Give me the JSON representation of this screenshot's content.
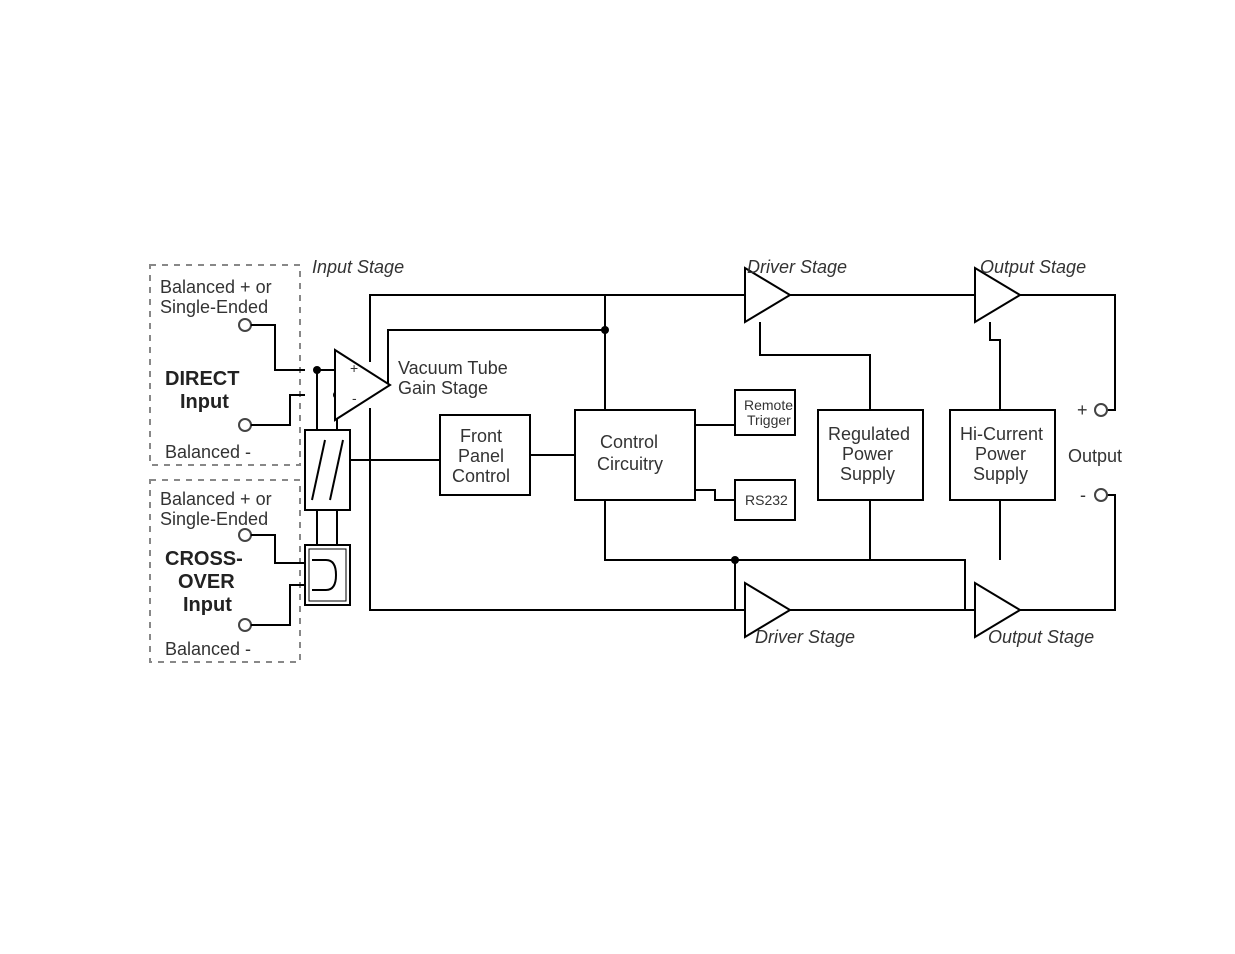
{
  "labels": {
    "input_stage": "Input Stage",
    "driver_stage": "Driver Stage",
    "output_stage": "Output Stage",
    "direct_input_1": "DIRECT",
    "direct_input_2": "Input",
    "crossover_1": "CROSS-",
    "crossover_2": "OVER",
    "crossover_3": "Input",
    "bal_pos_or": "Balanced + or",
    "single_ended": "Single-Ended",
    "bal_neg": "Balanced -",
    "vac_1": "Vacuum Tube",
    "vac_2": "Gain Stage",
    "fpc_1": "Front",
    "fpc_2": "Panel",
    "fpc_3": "Control",
    "ctrl_1": "Control",
    "ctrl_2": "Circuitry",
    "remote_1": "Remote",
    "remote_2": "Trigger",
    "rs232": "RS232",
    "reg_1": "Regulated",
    "reg_2": "Power",
    "reg_3": "Supply",
    "hic_1": "Hi-Current",
    "hic_2": "Power",
    "hic_3": "Supply",
    "out": "Output",
    "plus": "+",
    "minus": "-",
    "opamp_plus": "+",
    "opamp_minus": "-"
  }
}
